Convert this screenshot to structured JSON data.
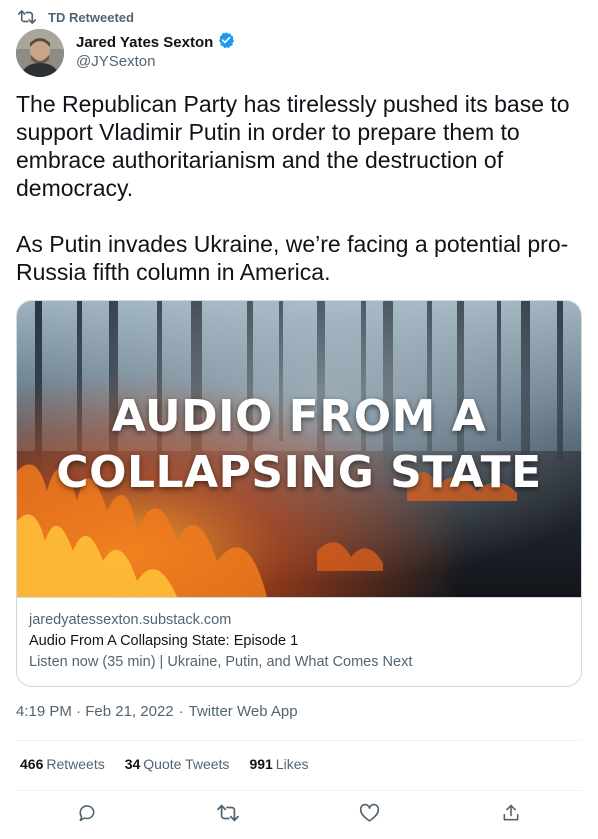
{
  "retweet": {
    "label": "TD Retweeted"
  },
  "author": {
    "name": "Jared Yates Sexton",
    "handle": "@JYSexton",
    "verified_color": "#1d9bf0"
  },
  "tweet": {
    "paragraph1": "The Republican Party has tirelessly pushed its base to support Vladimir Putin in order to prepare them to embrace authoritarianism and the destruction of democracy.",
    "paragraph2": "As Putin invades Ukraine, we’re facing a potential pro-Russia fifth column in America."
  },
  "card": {
    "overlay_line1": "AUDIO FROM A",
    "overlay_line2": "COLLAPSING STATE",
    "domain": "jaredyatessexton.substack.com",
    "title": "Audio From A Collapsing State: Episode 1",
    "description": "Listen now (35 min) | Ukraine, Putin, and What Comes Next"
  },
  "meta": {
    "time": "4:19 PM",
    "date": "Feb 21, 2022",
    "source": "Twitter Web App",
    "separator": "·"
  },
  "stats": {
    "retweets_count": "466",
    "retweets_label": "Retweets",
    "quotes_count": "34",
    "quotes_label": "Quote Tweets",
    "likes_count": "991",
    "likes_label": "Likes"
  },
  "icons": {
    "retweet": "retweet-icon",
    "verified": "verified-badge-icon",
    "reply": "reply-icon",
    "like": "heart-icon",
    "share": "share-icon"
  },
  "colors": {
    "text_primary": "#0f1419",
    "text_secondary": "#536471",
    "border": "#cfd9de"
  }
}
